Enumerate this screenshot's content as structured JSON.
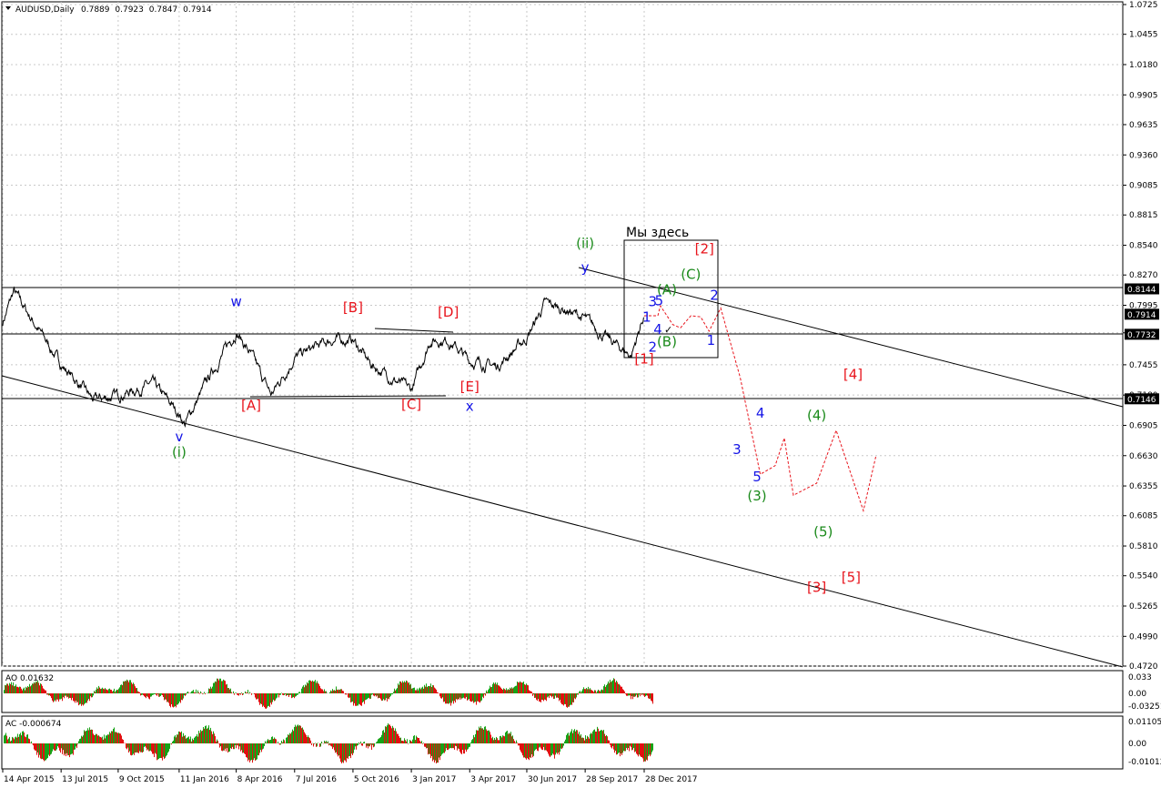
{
  "symbol_header": "AUDUSD,Daily",
  "ohlc": [
    "0.7889",
    "0.7923",
    "0.7847",
    "0.7914"
  ],
  "box_caption": "Мы здесь",
  "colors": {
    "price": "#000000",
    "grid": "#c8c8c8",
    "wave_red": "#e8141c",
    "wave_blue": "#1414e6",
    "wave_green": "#1a8a1a",
    "ao_up": "#17a317",
    "ao_down": "#e01010",
    "level_label_bg": "#000000"
  },
  "indicators": {
    "ao": {
      "label": "AO 0.01632",
      "ticks": [
        "0.033",
        "0.00",
        "-0.03251"
      ]
    },
    "ac": {
      "label": "AC -0.000674",
      "ticks": [
        "0.01105",
        "0.00",
        "-0.01012"
      ]
    }
  },
  "chart_data": {
    "type": "line",
    "title": "AUDUSD,Daily",
    "price_axis_ticks": [
      "1.0725",
      "1.0455",
      "1.0180",
      "0.9905",
      "0.9635",
      "0.9360",
      "0.9085",
      "0.8815",
      "0.8540",
      "0.8270",
      "0.7995",
      "0.7745",
      "0.7455",
      "0.7180",
      "0.6905",
      "0.6630",
      "0.6355",
      "0.6085",
      "0.5810",
      "0.5540",
      "0.5265",
      "0.4990",
      "0.4720"
    ],
    "ylim": [
      0.472,
      1.0725
    ],
    "x_tick_labels": [
      "14 Apr 2015",
      "13 Jul 2015",
      "9 Oct 2015",
      "11 Jan 2016",
      "8 Apr 2016",
      "7 Jul 2016",
      "5 Oct 2016",
      "3 Jan 2017",
      "3 Apr 2017",
      "30 Jun 2017",
      "28 Sep 2017",
      "28 Dec 2017"
    ],
    "horizontal_levels": [
      "0.8144",
      "0.7914",
      "0.7732",
      "0.7146"
    ],
    "series": [
      {
        "x": [
          "14 Apr 2015",
          "1 May 2015",
          "13 Jul 2015",
          "1 Sep 2015",
          "9 Oct 2015",
          "1 Dec 2015",
          "11 Jan 2016",
          "20 Jan 2016",
          "1 Mar 2016",
          "8 Apr 2016",
          "1 May 2016",
          "1 Jun 2016",
          "7 Jul 2016",
          "1 Sep 2016",
          "5 Oct 2016",
          "1 Nov 2016",
          "3 Jan 2017",
          "1 Feb 2017",
          "1 Mar 2017",
          "3 Apr 2017",
          "15 May 2017",
          "30 Jun 2017",
          "28 Jul 2017",
          "1 Sep 2017",
          "28 Sep 2017",
          "1 Nov 2017",
          "8 Dec 2017",
          "28 Dec 2017"
        ],
        "values": [
          0.784,
          0.812,
          0.746,
          0.713,
          0.718,
          0.728,
          0.701,
          0.692,
          0.738,
          0.776,
          0.754,
          0.718,
          0.752,
          0.768,
          0.768,
          0.746,
          0.722,
          0.768,
          0.768,
          0.749,
          0.744,
          0.77,
          0.801,
          0.795,
          0.787,
          0.769,
          0.754,
          0.7914
        ]
      }
    ],
    "wave_labels": [
      {
        "text": "w",
        "x": "8 Apr 2016",
        "y": 0.7985,
        "color": "blue"
      },
      {
        "text": "v",
        "x": "11 Jan 2016",
        "y": 0.676,
        "color": "blue"
      },
      {
        "text": "(i)",
        "x": "11 Jan 2016",
        "y": 0.662,
        "color": "green"
      },
      {
        "text": "[A]",
        "x": "1 May 2016",
        "y": 0.7045,
        "color": "red"
      },
      {
        "text": "[B]",
        "x": "5 Oct 2016",
        "y": 0.7935,
        "color": "red"
      },
      {
        "text": "[C]",
        "x": "3 Jan 2017",
        "y": 0.7055,
        "color": "red"
      },
      {
        "text": "[D]",
        "x": "1 Mar 2017",
        "y": 0.789,
        "color": "red"
      },
      {
        "text": "[E]",
        "x": "3 Apr 2017",
        "y": 0.7215,
        "color": "red"
      },
      {
        "text": "x",
        "x": "3 Apr 2017",
        "y": 0.7035,
        "color": "blue"
      },
      {
        "text": "y",
        "x": "28 Sep 2017",
        "y": 0.8295,
        "color": "blue"
      },
      {
        "text": "(ii)",
        "x": "28 Sep 2017",
        "y": 0.8515,
        "color": "green"
      },
      {
        "text": "[1]",
        "x": "28 Dec 2017",
        "y": 0.7465,
        "color": "red"
      },
      {
        "text": "[2]",
        "x": "31 Mar 2018",
        "y": 0.8465,
        "color": "red"
      },
      {
        "text": "[3]",
        "x": "20 Sep 2018",
        "y": 0.5395,
        "color": "red"
      },
      {
        "text": "[4]",
        "x": "15 Nov 2018",
        "y": 0.7325,
        "color": "red"
      },
      {
        "text": "[5]",
        "x": "12 Nov 2018",
        "y": 0.5485,
        "color": "red"
      },
      {
        "text": "(A)",
        "x": "1 Feb 2018",
        "y": 0.8095,
        "color": "green"
      },
      {
        "text": "(B)",
        "x": "1 Feb 2018",
        "y": 0.7625,
        "color": "green"
      },
      {
        "text": "(C)",
        "x": "10 Mar 2018",
        "y": 0.8235,
        "color": "green"
      },
      {
        "text": "(3)",
        "x": "20 Jun 2018",
        "y": 0.6225,
        "color": "green"
      },
      {
        "text": "(4)",
        "x": "20 Sep 2018",
        "y": 0.6955,
        "color": "green"
      },
      {
        "text": "(5)",
        "x": "30 Sep 2018",
        "y": 0.5895,
        "color": "green"
      },
      {
        "text": "1",
        "x": "1 Jan 2018",
        "y": 0.7845,
        "color": "blue"
      },
      {
        "text": "2",
        "x": "10 Jan 2018",
        "y": 0.7575,
        "color": "blue"
      },
      {
        "text": "3",
        "x": "10 Jan 2018",
        "y": 0.7985,
        "color": "blue"
      },
      {
        "text": "4",
        "x": "18 Jan 2018",
        "y": 0.7735,
        "color": "blue"
      },
      {
        "text": "5",
        "x": "20 Jan 2018",
        "y": 0.7995,
        "color": "blue"
      },
      {
        "text": "1",
        "x": "10 Apr 2018",
        "y": 0.7635,
        "color": "blue"
      },
      {
        "text": "2",
        "x": "15 Apr 2018",
        "y": 0.8045,
        "color": "blue"
      },
      {
        "text": "3",
        "x": "20 May 2018",
        "y": 0.6645,
        "color": "blue"
      },
      {
        "text": "4",
        "x": "25 Jun 2018",
        "y": 0.6975,
        "color": "blue"
      },
      {
        "text": "5",
        "x": "20 Jun 2018",
        "y": 0.6395,
        "color": "blue"
      }
    ],
    "forecast_path": {
      "x": [
        "28 Dec 2017",
        "18 Jan 2018",
        "22 Jan 2018",
        "10 Feb 2018",
        "22 Feb 2018",
        "10 Mar 2018",
        "25 Mar 2018",
        "7 Apr 2018",
        "25 Apr 2018",
        "25 May 2018",
        "25 Jun 2018",
        "18 Jul 2018",
        "1 Aug 2018",
        "15 Aug 2018",
        "20 Sep 2018",
        "20 Oct 2018",
        "1 Dec 2018",
        "20 Dec 2018"
      ],
      "values": [
        0.79,
        0.79,
        0.799,
        0.782,
        0.779,
        0.79,
        0.789,
        0.776,
        0.797,
        0.734,
        0.646,
        0.654,
        0.679,
        0.627,
        0.638,
        0.686,
        0.613,
        0.662
      ]
    }
  }
}
